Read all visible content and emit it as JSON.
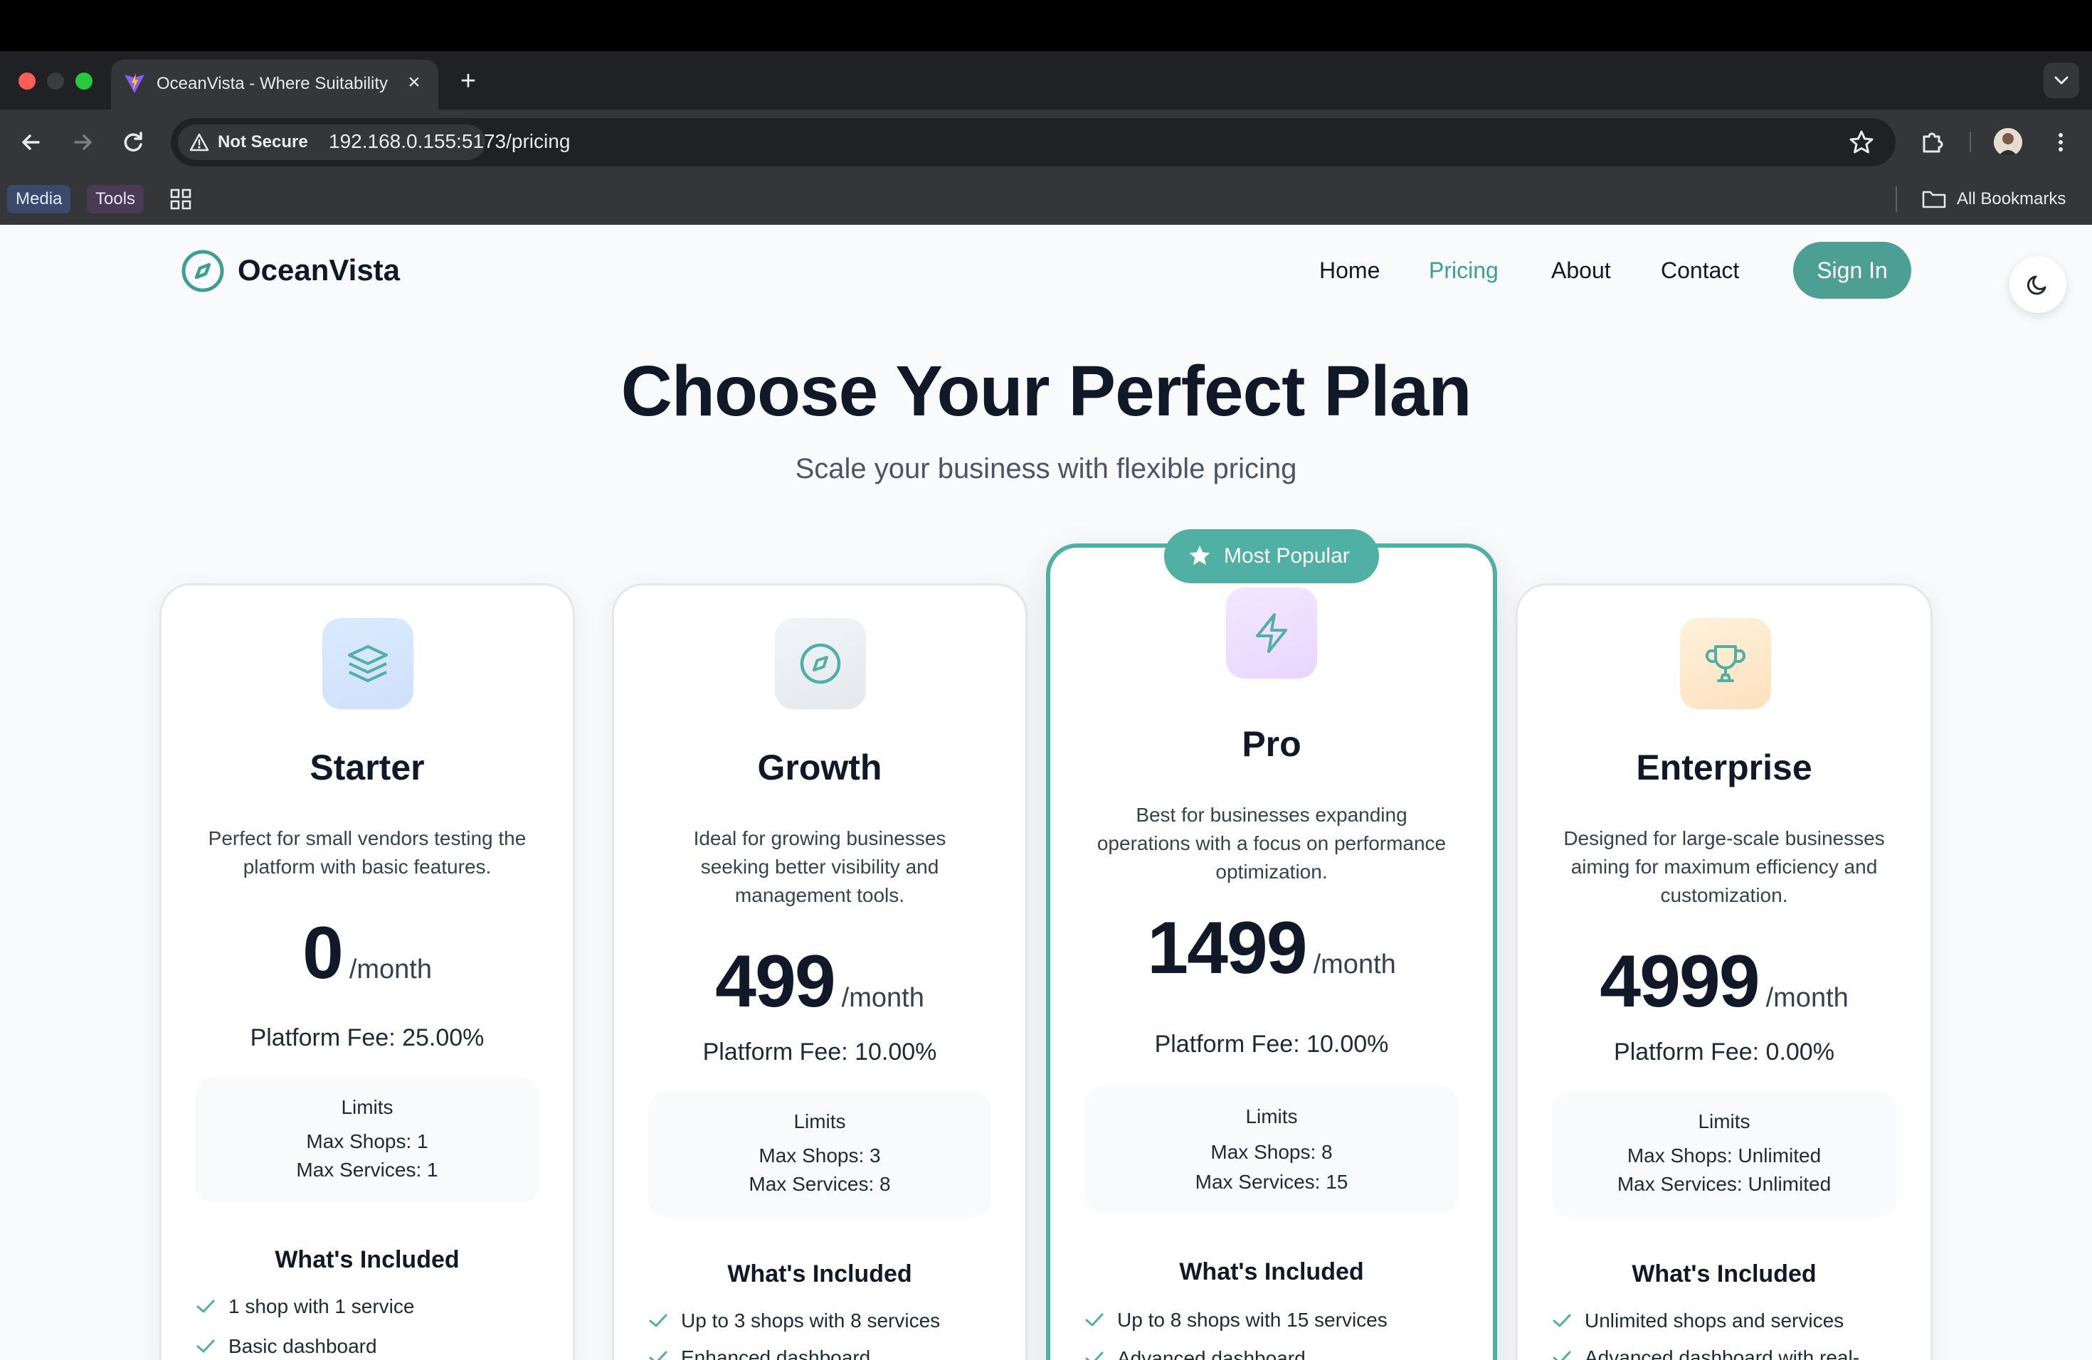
{
  "browser": {
    "tab_title": "OceanVista - Where Suitability",
    "tab_close": "×",
    "new_tab": "+",
    "not_secure": "Not Secure",
    "url": "192.168.0.155:5173/pricing",
    "bookmarks": [
      "Media",
      "Tools"
    ],
    "all_bookmarks": "All Bookmarks"
  },
  "nav": {
    "brand": "OceanVista",
    "links": [
      "Home",
      "Pricing",
      "About",
      "Contact"
    ],
    "active": "Pricing",
    "sign_in": "Sign In"
  },
  "hero": {
    "title": "Choose Your Perfect Plan",
    "subtitle": "Scale your business with flexible pricing"
  },
  "plans": [
    {
      "name": "Starter",
      "icon": "layers-icon",
      "description": "Perfect for small vendors testing the platform with basic features.",
      "price": "0",
      "period": "/month",
      "platform_fee": "Platform Fee: 25.00%",
      "limits_title": "Limits",
      "max_shops": "Max Shops: 1",
      "max_services": "Max Services: 1",
      "included_title": "What's Included",
      "features": [
        "1 shop with 1 service",
        "Basic dashboard"
      ]
    },
    {
      "name": "Growth",
      "icon": "compass-icon",
      "description": "Ideal for growing businesses seeking better visibility and management tools.",
      "price": "499",
      "period": "/month",
      "platform_fee": "Platform Fee: 10.00%",
      "limits_title": "Limits",
      "max_shops": "Max Shops: 3",
      "max_services": "Max Services: 8",
      "included_title": "What's Included",
      "features": [
        "Up to 3 shops with 8 services",
        "Enhanced dashboard"
      ]
    },
    {
      "name": "Pro",
      "icon": "lightning-icon",
      "badge": "Most Popular",
      "description": "Best for businesses expanding operations with a focus on performance optimization.",
      "price": "1499",
      "period": "/month",
      "platform_fee": "Platform Fee: 10.00%",
      "limits_title": "Limits",
      "max_shops": "Max Shops: 8",
      "max_services": "Max Services: 15",
      "included_title": "What's Included",
      "features": [
        "Up to 8 shops with 15 services",
        "Advanced dashboard"
      ]
    },
    {
      "name": "Enterprise",
      "icon": "trophy-icon",
      "description": "Designed for large-scale businesses aiming for maximum efficiency and customization.",
      "price": "4999",
      "period": "/month",
      "platform_fee": "Platform Fee: 0.00%",
      "limits_title": "Limits",
      "max_shops": "Max Shops: Unlimited",
      "max_services": "Max Services: Unlimited",
      "included_title": "What's Included",
      "features": [
        "Unlimited shops and services",
        "Advanced dashboard with real-"
      ]
    }
  ],
  "colors": {
    "accent": "#4d9e93",
    "popular_border": "#4fb0a3",
    "text_dark": "#111827"
  }
}
